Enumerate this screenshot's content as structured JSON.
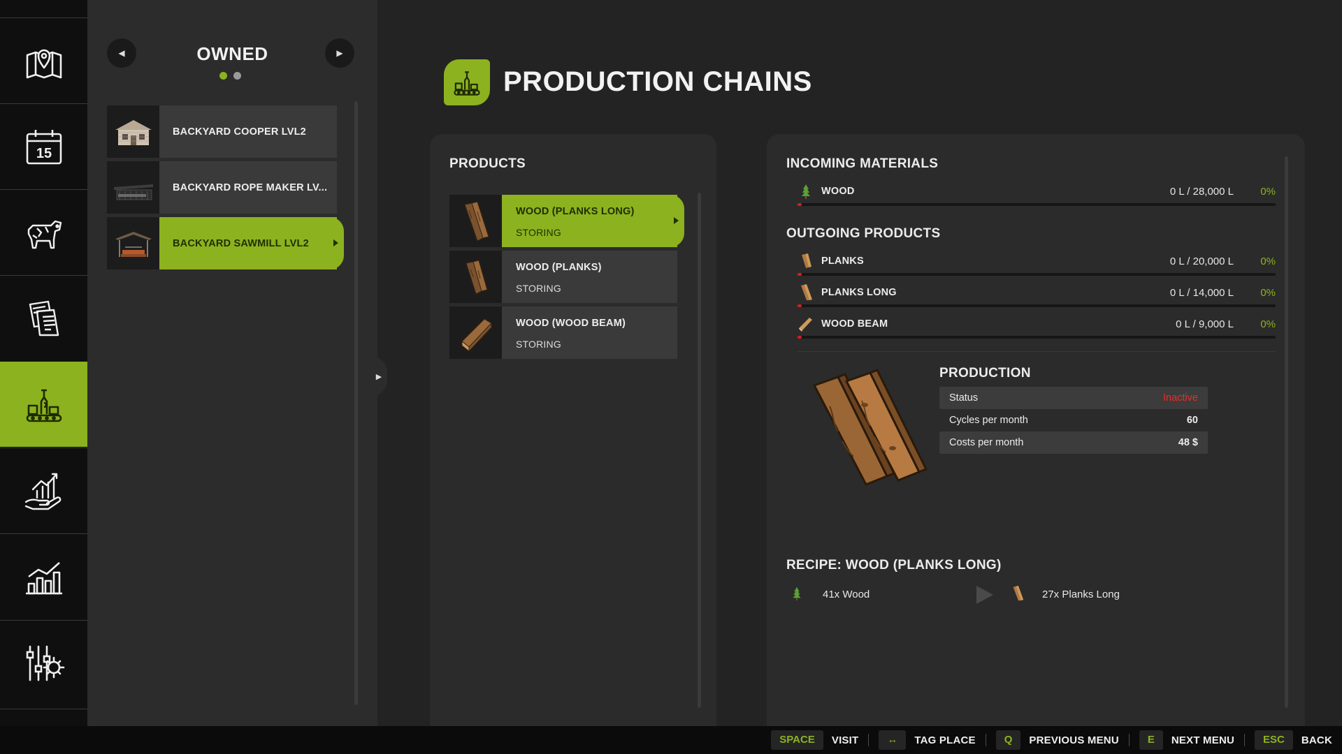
{
  "rail": {
    "items": [
      {
        "name": "map",
        "icon": "map-pin-icon"
      },
      {
        "name": "calendar",
        "icon": "calendar-icon",
        "label": "15"
      },
      {
        "name": "animals",
        "icon": "cow-icon"
      },
      {
        "name": "contracts",
        "icon": "documents-icon"
      },
      {
        "name": "production",
        "icon": "factory-icon",
        "active": true
      },
      {
        "name": "finances",
        "icon": "growth-hand-icon"
      },
      {
        "name": "statistics",
        "icon": "bar-chart-icon"
      },
      {
        "name": "settings",
        "icon": "sliders-gear-icon"
      }
    ]
  },
  "places": {
    "title": "OWNED",
    "page_dots": 2,
    "active_dot": 0,
    "items": [
      {
        "label": "BACKYARD COOPER LVL2",
        "selected": false
      },
      {
        "label": "BACKYARD ROPE MAKER LV...",
        "selected": false
      },
      {
        "label": "BACKYARD SAWMILL LVL2",
        "selected": true
      }
    ]
  },
  "page": {
    "title": "PRODUCTION CHAINS"
  },
  "products": {
    "heading": "PRODUCTS",
    "items": [
      {
        "name": "WOOD (PLANKS LONG)",
        "status": "STORING",
        "selected": true
      },
      {
        "name": "WOOD (PLANKS)",
        "status": "STORING",
        "selected": false
      },
      {
        "name": "WOOD (WOOD BEAM)",
        "status": "STORING",
        "selected": false
      }
    ]
  },
  "incoming": {
    "heading": "INCOMING MATERIALS",
    "items": [
      {
        "name": "WOOD",
        "amount": "0 L / 28,000 L",
        "pct": "0%",
        "fill": 0.0
      }
    ]
  },
  "outgoing": {
    "heading": "OUTGOING PRODUCTS",
    "items": [
      {
        "name": "PLANKS",
        "amount": "0 L / 20,000 L",
        "pct": "0%",
        "fill": 0.0
      },
      {
        "name": "PLANKS LONG",
        "amount": "0 L / 14,000 L",
        "pct": "0%",
        "fill": 0.0
      },
      {
        "name": "WOOD BEAM",
        "amount": "0 L / 9,000 L",
        "pct": "0%",
        "fill": 0.0
      }
    ]
  },
  "production": {
    "heading": "PRODUCTION",
    "status_label": "Status",
    "status_value": "Inactive",
    "cycles_label": "Cycles per month",
    "cycles_value": "60",
    "costs_label": "Costs per month",
    "costs_value": "48 $"
  },
  "recipe": {
    "heading": "RECIPE: WOOD (PLANKS LONG)",
    "input": "41x Wood",
    "output": "27x Planks Long"
  },
  "hints": [
    {
      "key": "SPACE",
      "label": "VISIT"
    },
    {
      "key": "↔",
      "label": "TAG PLACE"
    },
    {
      "key": "Q",
      "label": "PREVIOUS MENU"
    },
    {
      "key": "E",
      "label": "NEXT MENU"
    },
    {
      "key": "ESC",
      "label": "BACK"
    }
  ],
  "colors": {
    "accent": "#8cb21f",
    "inactive": "#e3302a",
    "bar_fill": "#d32020"
  }
}
